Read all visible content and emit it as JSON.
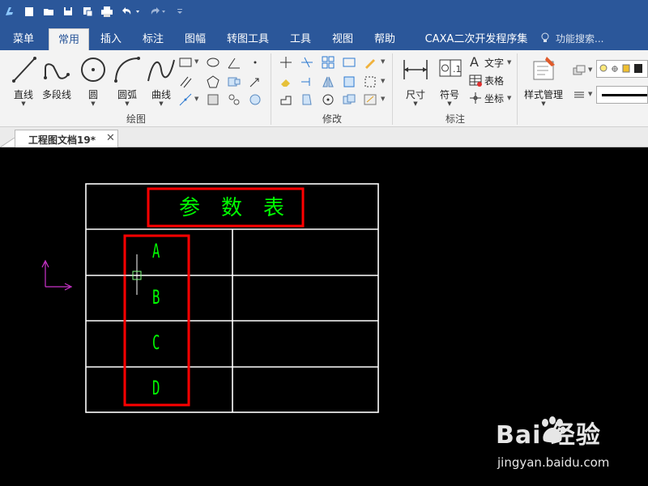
{
  "quick_access": {
    "icons": [
      "app-logo-icon",
      "new-file-icon",
      "open-file-icon",
      "save-icon",
      "save-as-icon",
      "print-icon",
      "undo-icon",
      "redo-icon",
      "customize-icon"
    ]
  },
  "menubar": {
    "tabs": [
      {
        "label": "菜单"
      },
      {
        "label": "常用"
      },
      {
        "label": "插入"
      },
      {
        "label": "标注"
      },
      {
        "label": "图幅"
      },
      {
        "label": "转图工具"
      },
      {
        "label": "工具"
      },
      {
        "label": "视图"
      },
      {
        "label": "帮助"
      },
      {
        "label": "CAXA二次开发程序集"
      }
    ],
    "active_tab": "常用",
    "search_placeholder": "功能搜索..."
  },
  "ribbon": {
    "draw_group": {
      "label": "绘图",
      "buttons": [
        {
          "label": "直线"
        },
        {
          "label": "多段线"
        },
        {
          "label": "圆"
        },
        {
          "label": "圆弧"
        },
        {
          "label": "曲线"
        }
      ]
    },
    "modify_group": {
      "label": "修改"
    },
    "annotate_group": {
      "label": "标注",
      "buttons": [
        {
          "label": "尺寸"
        },
        {
          "label": "符号"
        }
      ],
      "small_buttons": [
        {
          "label": "文字"
        },
        {
          "label": "表格"
        },
        {
          "label": "坐标"
        }
      ]
    },
    "style_group": {
      "buttons": [
        {
          "label": "样式管理"
        }
      ]
    }
  },
  "document": {
    "tab_title": "工程图文档19*",
    "close_glyph": "✕"
  },
  "drawing": {
    "table_title": "参　数　表",
    "rows": [
      {
        "label": "A"
      },
      {
        "label": "B"
      },
      {
        "label": "C"
      },
      {
        "label": "D"
      }
    ],
    "colors": {
      "table_lines": "#ffffff",
      "text": "#00ff00",
      "highlight_box": "#ff0000",
      "axis_gizmo": "#cc33cc",
      "background": "#000000"
    }
  },
  "watermark": {
    "brand": "Bai 经验",
    "url": "jingyan.baidu.com"
  }
}
